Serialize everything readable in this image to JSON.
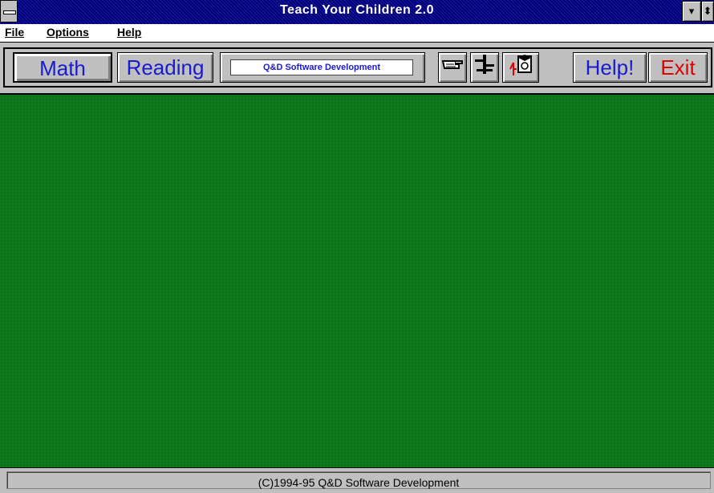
{
  "window": {
    "title": "Teach Your Children 2.0",
    "minimize_glyph": "▾",
    "maximize_glyph": "⬍"
  },
  "menubar": {
    "items": [
      {
        "label": "File"
      },
      {
        "label": "Options"
      },
      {
        "label": "Help"
      }
    ]
  },
  "toolbar": {
    "math_label": "Math",
    "reading_label": "Reading",
    "company_label": "Q&D Software Development",
    "help_label": "Help!",
    "exit_label": "Exit",
    "icons": [
      "pointing-hand-icon",
      "scale-icon",
      "graduate-icon"
    ],
    "accent_color": "#1a1ad0",
    "exit_color": "#e00000"
  },
  "main": {
    "background_color": "#0b7a1a"
  },
  "statusbar": {
    "text": "(C)1994-95 Q&D Software Development"
  }
}
